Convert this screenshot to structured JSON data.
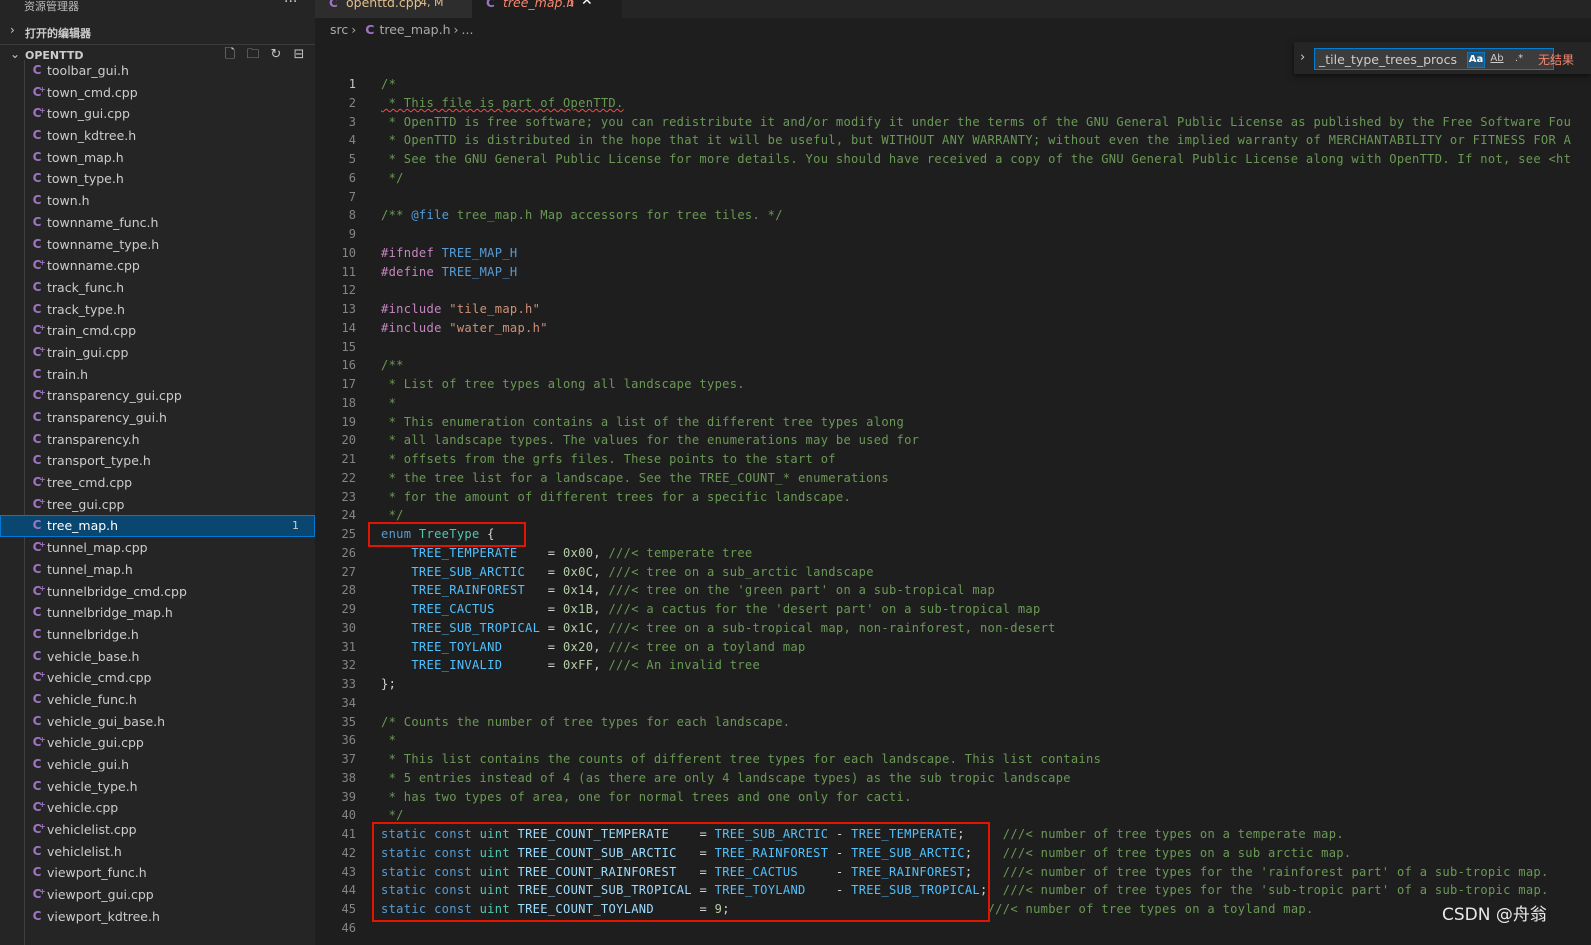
{
  "sidebar": {
    "header_title": "资源管理器",
    "more_label": "···",
    "open_editors_label": "打开的编辑器",
    "project_label": "OPENTTD",
    "files": [
      {
        "name": "toolbar_gui.h",
        "type": "h"
      },
      {
        "name": "town_cmd.cpp",
        "type": "cpp"
      },
      {
        "name": "town_gui.cpp",
        "type": "cpp"
      },
      {
        "name": "town_kdtree.h",
        "type": "h"
      },
      {
        "name": "town_map.h",
        "type": "h"
      },
      {
        "name": "town_type.h",
        "type": "h"
      },
      {
        "name": "town.h",
        "type": "h"
      },
      {
        "name": "townname_func.h",
        "type": "h"
      },
      {
        "name": "townname_type.h",
        "type": "h"
      },
      {
        "name": "townname.cpp",
        "type": "cpp"
      },
      {
        "name": "track_func.h",
        "type": "h"
      },
      {
        "name": "track_type.h",
        "type": "h"
      },
      {
        "name": "train_cmd.cpp",
        "type": "cpp"
      },
      {
        "name": "train_gui.cpp",
        "type": "cpp"
      },
      {
        "name": "train.h",
        "type": "h"
      },
      {
        "name": "transparency_gui.cpp",
        "type": "cpp"
      },
      {
        "name": "transparency_gui.h",
        "type": "h"
      },
      {
        "name": "transparency.h",
        "type": "h"
      },
      {
        "name": "transport_type.h",
        "type": "h"
      },
      {
        "name": "tree_cmd.cpp",
        "type": "cpp"
      },
      {
        "name": "tree_gui.cpp",
        "type": "cpp"
      },
      {
        "name": "tree_map.h",
        "type": "h",
        "selected": true,
        "badge": "1"
      },
      {
        "name": "tunnel_map.cpp",
        "type": "cpp"
      },
      {
        "name": "tunnel_map.h",
        "type": "h"
      },
      {
        "name": "tunnelbridge_cmd.cpp",
        "type": "cpp"
      },
      {
        "name": "tunnelbridge_map.h",
        "type": "h"
      },
      {
        "name": "tunnelbridge.h",
        "type": "h"
      },
      {
        "name": "vehicle_base.h",
        "type": "h"
      },
      {
        "name": "vehicle_cmd.cpp",
        "type": "cpp"
      },
      {
        "name": "vehicle_func.h",
        "type": "h"
      },
      {
        "name": "vehicle_gui_base.h",
        "type": "h"
      },
      {
        "name": "vehicle_gui.cpp",
        "type": "cpp"
      },
      {
        "name": "vehicle_gui.h",
        "type": "h"
      },
      {
        "name": "vehicle_type.h",
        "type": "h"
      },
      {
        "name": "vehicle.cpp",
        "type": "cpp"
      },
      {
        "name": "vehiclelist.cpp",
        "type": "cpp"
      },
      {
        "name": "vehiclelist.h",
        "type": "h"
      },
      {
        "name": "viewport_func.h",
        "type": "h"
      },
      {
        "name": "viewport_gui.cpp",
        "type": "cpp"
      },
      {
        "name": "viewport_kdtree.h",
        "type": "h"
      }
    ]
  },
  "tabs": [
    {
      "name": "openttd.cpp",
      "status": "4, M"
    },
    {
      "name": "tree_map.h",
      "status": "1",
      "close": "✕"
    }
  ],
  "breadcrumb": {
    "folder": "src",
    "file": "tree_map.h",
    "more": "..."
  },
  "find": {
    "value": "_tile_type_trees_procs",
    "case_label": "Aa",
    "word_label": "Ab",
    "regex_label": ".*",
    "no_results": "无结果"
  },
  "editor": {
    "active_line": 1,
    "lines": [
      {
        "n": 1,
        "t": [
          [
            "cm",
            "/*"
          ]
        ]
      },
      {
        "n": 2,
        "t": [
          [
            "cm",
            " * This file is part of OpenTTD.",
            "sq"
          ]
        ]
      },
      {
        "n": 3,
        "t": [
          [
            "cm",
            " * OpenTTD is free software; you can redistribute it and/or modify it under the terms of the GNU General Public License as published by the Free Software Fou"
          ]
        ]
      },
      {
        "n": 4,
        "t": [
          [
            "cm",
            " * OpenTTD is distributed in the hope that it will be useful, but WITHOUT ANY WARRANTY; without even the implied warranty of MERCHANTABILITY or FITNESS FOR A"
          ]
        ]
      },
      {
        "n": 5,
        "t": [
          [
            "cm",
            " * See the GNU General Public License for more details. You should have received a copy of the GNU General Public License along with OpenTTD. If not, see <ht"
          ]
        ]
      },
      {
        "n": 6,
        "t": [
          [
            "cm",
            " */"
          ]
        ]
      },
      {
        "n": 7,
        "t": []
      },
      {
        "n": 8,
        "t": [
          [
            "cm",
            "/** "
          ],
          [
            "doc",
            "@file"
          ],
          [
            "cm",
            " tree_map.h Map accessors for tree tiles. */"
          ]
        ]
      },
      {
        "n": 9,
        "t": []
      },
      {
        "n": 10,
        "t": [
          [
            "pp",
            "#ifndef"
          ],
          [
            "op",
            " "
          ],
          [
            "kw",
            "TREE_MAP_H"
          ]
        ]
      },
      {
        "n": 11,
        "t": [
          [
            "pp",
            "#define"
          ],
          [
            "op",
            " "
          ],
          [
            "kw",
            "TREE_MAP_H"
          ]
        ]
      },
      {
        "n": 12,
        "t": []
      },
      {
        "n": 13,
        "t": [
          [
            "pp",
            "#include"
          ],
          [
            "op",
            " "
          ],
          [
            "str",
            "\"tile_map.h\""
          ]
        ]
      },
      {
        "n": 14,
        "t": [
          [
            "pp",
            "#include"
          ],
          [
            "op",
            " "
          ],
          [
            "str",
            "\"water_map.h\""
          ]
        ]
      },
      {
        "n": 15,
        "t": []
      },
      {
        "n": 16,
        "t": [
          [
            "cm",
            "/**"
          ]
        ]
      },
      {
        "n": 17,
        "t": [
          [
            "cm",
            " * List of tree types along all landscape types."
          ]
        ]
      },
      {
        "n": 18,
        "t": [
          [
            "cm",
            " *"
          ]
        ]
      },
      {
        "n": 19,
        "t": [
          [
            "cm",
            " * This enumeration contains a list of the different tree types along"
          ]
        ]
      },
      {
        "n": 20,
        "t": [
          [
            "cm",
            " * all landscape types. The values for the enumerations may be used for"
          ]
        ]
      },
      {
        "n": 21,
        "t": [
          [
            "cm",
            " * offsets from the grfs files. These points to the start of"
          ]
        ]
      },
      {
        "n": 22,
        "t": [
          [
            "cm",
            " * the tree list for a landscape. See the TREE_COUNT_* enumerations"
          ]
        ]
      },
      {
        "n": 23,
        "t": [
          [
            "cm",
            " * for the amount of different trees for a specific landscape."
          ]
        ]
      },
      {
        "n": 24,
        "t": [
          [
            "cm",
            " */"
          ]
        ]
      },
      {
        "n": 25,
        "t": [
          [
            "kw",
            "enum"
          ],
          [
            "op",
            " "
          ],
          [
            "type",
            "TreeType"
          ],
          [
            "op",
            " {"
          ]
        ]
      },
      {
        "n": 26,
        "t": [
          [
            "op",
            "    "
          ],
          [
            "enum",
            "TREE_TEMPERATE"
          ],
          [
            "op",
            "    = "
          ],
          [
            "num",
            "0x00"
          ],
          [
            "op",
            ", "
          ],
          [
            "cm",
            "///< temperate tree"
          ]
        ]
      },
      {
        "n": 27,
        "t": [
          [
            "op",
            "    "
          ],
          [
            "enum",
            "TREE_SUB_ARCTIC"
          ],
          [
            "op",
            "   = "
          ],
          [
            "num",
            "0x0C"
          ],
          [
            "op",
            ", "
          ],
          [
            "cm",
            "///< tree on a sub_arctic landscape"
          ]
        ]
      },
      {
        "n": 28,
        "t": [
          [
            "op",
            "    "
          ],
          [
            "enum",
            "TREE_RAINFOREST"
          ],
          [
            "op",
            "   = "
          ],
          [
            "num",
            "0x14"
          ],
          [
            "op",
            ", "
          ],
          [
            "cm",
            "///< tree on the 'green part' on a sub-tropical map"
          ]
        ]
      },
      {
        "n": 29,
        "t": [
          [
            "op",
            "    "
          ],
          [
            "enum",
            "TREE_CACTUS"
          ],
          [
            "op",
            "       = "
          ],
          [
            "num",
            "0x1B"
          ],
          [
            "op",
            ", "
          ],
          [
            "cm",
            "///< a cactus for the 'desert part' on a sub-tropical map"
          ]
        ]
      },
      {
        "n": 30,
        "t": [
          [
            "op",
            "    "
          ],
          [
            "enum",
            "TREE_SUB_TROPICAL"
          ],
          [
            "op",
            " = "
          ],
          [
            "num",
            "0x1C"
          ],
          [
            "op",
            ", "
          ],
          [
            "cm",
            "///< tree on a sub-tropical map, non-rainforest, non-desert"
          ]
        ]
      },
      {
        "n": 31,
        "t": [
          [
            "op",
            "    "
          ],
          [
            "enum",
            "TREE_TOYLAND"
          ],
          [
            "op",
            "      = "
          ],
          [
            "num",
            "0x20"
          ],
          [
            "op",
            ", "
          ],
          [
            "cm",
            "///< tree on a toyland map"
          ]
        ]
      },
      {
        "n": 32,
        "t": [
          [
            "op",
            "    "
          ],
          [
            "enum",
            "TREE_INVALID"
          ],
          [
            "op",
            "      = "
          ],
          [
            "num",
            "0xFF"
          ],
          [
            "op",
            ", "
          ],
          [
            "cm",
            "///< An invalid tree"
          ]
        ]
      },
      {
        "n": 33,
        "t": [
          [
            "op",
            "};"
          ]
        ]
      },
      {
        "n": 34,
        "t": []
      },
      {
        "n": 35,
        "t": [
          [
            "cm",
            "/* Counts the number of tree types for each landscape."
          ]
        ]
      },
      {
        "n": 36,
        "t": [
          [
            "cm",
            " *"
          ]
        ]
      },
      {
        "n": 37,
        "t": [
          [
            "cm",
            " * This list contains the counts of different tree types for each landscape. This list contains"
          ]
        ]
      },
      {
        "n": 38,
        "t": [
          [
            "cm",
            " * 5 entries instead of 4 (as there are only 4 landscape types) as the sub tropic landscape"
          ]
        ]
      },
      {
        "n": 39,
        "t": [
          [
            "cm",
            " * has two types of area, one for normal trees and one only for cacti."
          ]
        ]
      },
      {
        "n": 40,
        "t": [
          [
            "cm",
            " */"
          ]
        ]
      },
      {
        "n": 41,
        "t": [
          [
            "kw",
            "static"
          ],
          [
            "op",
            " "
          ],
          [
            "kw",
            "const"
          ],
          [
            "op",
            " "
          ],
          [
            "type",
            "uint"
          ],
          [
            "op",
            " "
          ],
          [
            "id",
            "TREE_COUNT_TEMPERATE"
          ],
          [
            "op",
            "    = "
          ],
          [
            "enum",
            "TREE_SUB_ARCTIC"
          ],
          [
            "op",
            " - "
          ],
          [
            "enum",
            "TREE_TEMPERATE"
          ],
          [
            "op",
            ";     "
          ],
          [
            "cm",
            "///< number of tree types on a temperate map."
          ]
        ]
      },
      {
        "n": 42,
        "t": [
          [
            "kw",
            "static"
          ],
          [
            "op",
            " "
          ],
          [
            "kw",
            "const"
          ],
          [
            "op",
            " "
          ],
          [
            "type",
            "uint"
          ],
          [
            "op",
            " "
          ],
          [
            "id",
            "TREE_COUNT_SUB_ARCTIC"
          ],
          [
            "op",
            "   = "
          ],
          [
            "enum",
            "TREE_RAINFOREST"
          ],
          [
            "op",
            " - "
          ],
          [
            "enum",
            "TREE_SUB_ARCTIC"
          ],
          [
            "op",
            ";    "
          ],
          [
            "cm",
            "///< number of tree types on a sub arctic map."
          ]
        ]
      },
      {
        "n": 43,
        "t": [
          [
            "kw",
            "static"
          ],
          [
            "op",
            " "
          ],
          [
            "kw",
            "const"
          ],
          [
            "op",
            " "
          ],
          [
            "type",
            "uint"
          ],
          [
            "op",
            " "
          ],
          [
            "id",
            "TREE_COUNT_RAINFOREST"
          ],
          [
            "op",
            "   = "
          ],
          [
            "enum",
            "TREE_CACTUS"
          ],
          [
            "op",
            "     - "
          ],
          [
            "enum",
            "TREE_RAINFOREST"
          ],
          [
            "op",
            ";    "
          ],
          [
            "cm",
            "///< number of tree types for the 'rainforest part' of a sub-tropic map."
          ]
        ]
      },
      {
        "n": 44,
        "t": [
          [
            "kw",
            "static"
          ],
          [
            "op",
            " "
          ],
          [
            "kw",
            "const"
          ],
          [
            "op",
            " "
          ],
          [
            "type",
            "uint"
          ],
          [
            "op",
            " "
          ],
          [
            "id",
            "TREE_COUNT_SUB_TROPICAL"
          ],
          [
            "op",
            " = "
          ],
          [
            "enum",
            "TREE_TOYLAND"
          ],
          [
            "op",
            "    - "
          ],
          [
            "enum",
            "TREE_SUB_TROPICAL"
          ],
          [
            "op",
            ";  "
          ],
          [
            "cm",
            "///< number of tree types for the 'sub-tropic part' of a sub-tropic map."
          ]
        ]
      },
      {
        "n": 45,
        "t": [
          [
            "kw",
            "static"
          ],
          [
            "op",
            " "
          ],
          [
            "kw",
            "const"
          ],
          [
            "op",
            " "
          ],
          [
            "type",
            "uint"
          ],
          [
            "op",
            " "
          ],
          [
            "id",
            "TREE_COUNT_TOYLAND"
          ],
          [
            "op",
            "      = "
          ],
          [
            "num",
            "9"
          ],
          [
            "op",
            ";                                  "
          ],
          [
            "cm",
            "///< number of tree types on a toyland map."
          ]
        ]
      },
      {
        "n": 46,
        "t": []
      }
    ]
  },
  "watermark": "CSDN @舟翁",
  "colors": {
    "accent": "#0078d4",
    "selection": "#094771",
    "error": "#e51400",
    "comment": "#6a9955",
    "keyword": "#569cd6"
  }
}
